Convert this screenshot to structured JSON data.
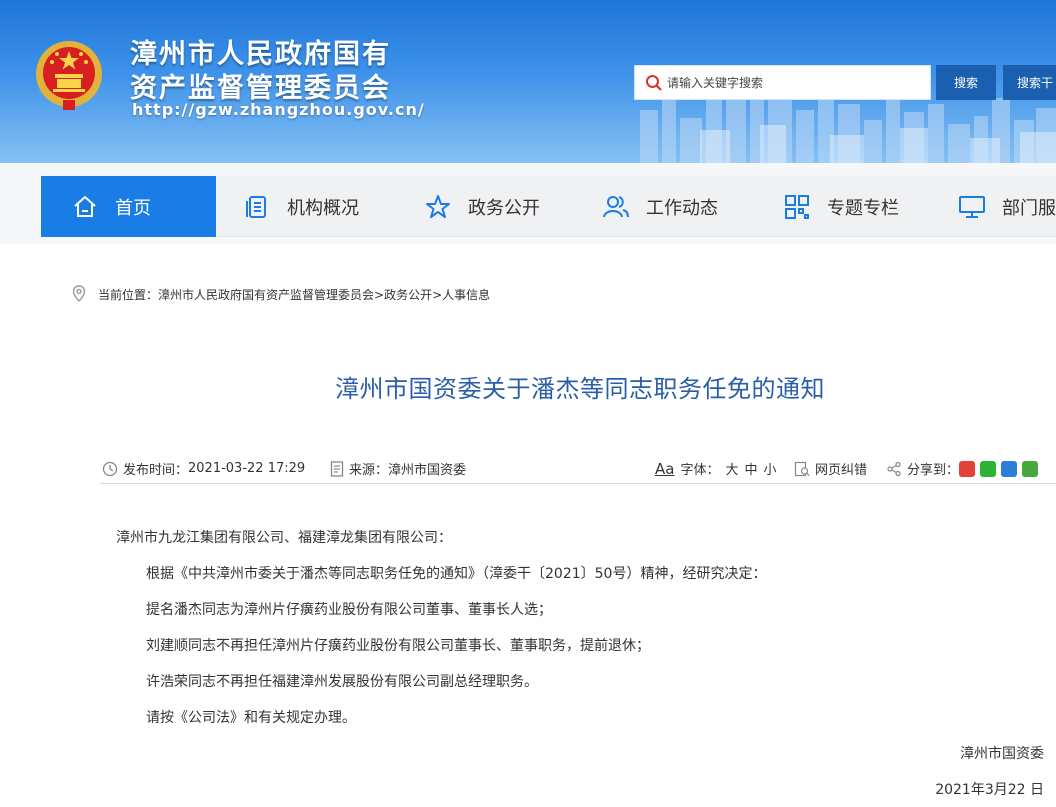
{
  "header": {
    "title_line1": "漳州市人民政府国有",
    "title_line2": "资产监督管理委员会",
    "url": "http://gzw.zhangzhou.gov.cn/",
    "search_placeholder": "请输入关键字搜索",
    "search_button": "搜索",
    "search_button2": "搜索干"
  },
  "nav": {
    "items": [
      {
        "label": "首页",
        "icon": "home-icon"
      },
      {
        "label": "机构概况",
        "icon": "document-list-icon"
      },
      {
        "label": "政务公开",
        "icon": "star-icon"
      },
      {
        "label": "工作动态",
        "icon": "people-icon"
      },
      {
        "label": "专题专栏",
        "icon": "grid-icon"
      },
      {
        "label": "部门服",
        "icon": "monitor-icon"
      }
    ]
  },
  "breadcrumb": {
    "prefix": "当前位置：",
    "path": "漳州市人民政府国有资产监督管理委员会>政务公开>人事信息"
  },
  "article": {
    "title": "漳州市国资委关于潘杰等同志职务任免的通知",
    "publish_label": "发布时间：",
    "publish_time": "2021-03-22 17:29",
    "source_label": "来源：",
    "source": "漳州市国资委",
    "font_icon_text": "Aa",
    "font_label": "字体：",
    "font_large": "大",
    "font_medium": "中",
    "font_small": "小",
    "error_label": "网页纠错",
    "share_label": "分享到：",
    "paragraphs": [
      "漳州市九龙江集团有限公司、福建漳龙集团有限公司：",
      "根据《中共漳州市委关于潘杰等同志职务任免的通知》（漳委干〔2021〕50号）精神，经研究决定：",
      "提名潘杰同志为漳州片仔癀药业股份有限公司董事、董事长人选；",
      "刘建顺同志不再担任漳州片仔癀药业股份有限公司董事长、董事职务，提前退休；",
      "许浩荣同志不再担任福建漳州发展股份有限公司副总经理职务。",
      "请按《公司法》和有关规定办理。"
    ],
    "signature": "漳州市国资委",
    "date": "2021年3月22 日"
  },
  "colors": {
    "nav_active": "#1a7de6",
    "title": "#2a5ea9",
    "header": "#2f86e0"
  }
}
